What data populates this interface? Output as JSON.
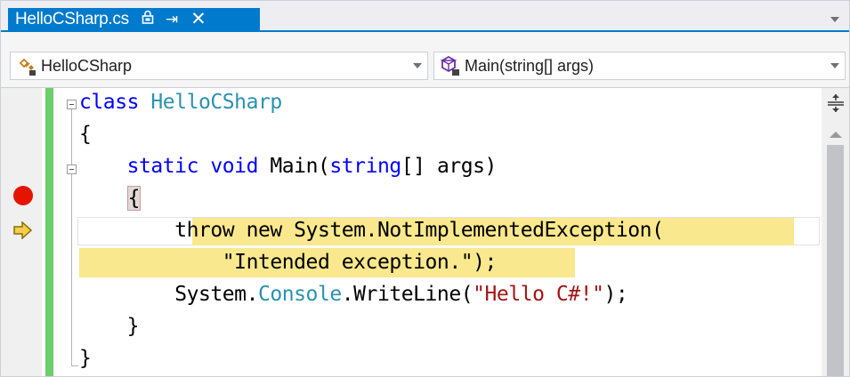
{
  "tab": {
    "title": "HelloCSharp.cs",
    "lock_icon": "lock-icon",
    "pin_icon": "⇥",
    "close_icon": "✕"
  },
  "navbar": {
    "left_label": "HelloCSharp",
    "right_label": "Main(string[] args)"
  },
  "code": {
    "line1_kw": "class",
    "line1_type": "HelloCSharp",
    "line2": "{",
    "line3_static": "static",
    "line3_void": "void",
    "line3_name": "Main(",
    "line3_string": "string",
    "line3_rest": "[] args)",
    "line4_brace": "{",
    "line5_a": "throw new System.NotImplementedException(",
    "line6_str": "\"Intended exception.\"",
    "line6_end": ");",
    "line7_a": "System.",
    "line7_type": "Console",
    "line7_b": ".WriteLine(",
    "line7_str": "\"Hello C#!\"",
    "line7_end": ");",
    "line8": "}",
    "line9": "}"
  },
  "colors": {
    "accent": "#007acc",
    "breakpoint": "#e51400",
    "current_statement": "#f9e88d",
    "change_bar": "#6bcd6b"
  }
}
